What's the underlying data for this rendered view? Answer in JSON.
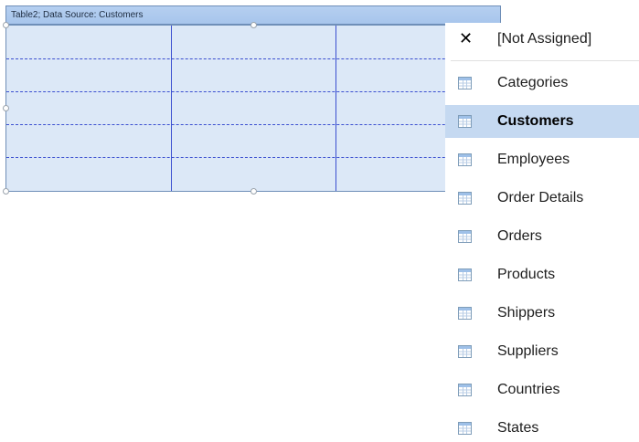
{
  "table": {
    "header_text": "Table2; Data Source: Customers",
    "columns": 3,
    "rows": 5
  },
  "menu": {
    "not_assigned": {
      "label": "[Not Assigned]",
      "icon": "close-icon"
    },
    "items": [
      {
        "label": "Categories",
        "icon": "table-icon",
        "selected": false
      },
      {
        "label": "Customers",
        "icon": "table-icon",
        "selected": true
      },
      {
        "label": "Employees",
        "icon": "table-icon",
        "selected": false
      },
      {
        "label": "Order Details",
        "icon": "table-icon",
        "selected": false
      },
      {
        "label": "Orders",
        "icon": "table-icon",
        "selected": false
      },
      {
        "label": "Products",
        "icon": "table-icon",
        "selected": false
      },
      {
        "label": "Shippers",
        "icon": "table-icon",
        "selected": false
      },
      {
        "label": "Suppliers",
        "icon": "table-icon",
        "selected": false
      },
      {
        "label": "Countries",
        "icon": "table-icon",
        "selected": false
      },
      {
        "label": "States",
        "icon": "table-icon",
        "selected": false
      }
    ]
  },
  "colors": {
    "selected_background": "#c5d9f1",
    "table_background": "#dce8f7",
    "grid_lines": "#3b4fd0",
    "header_background": "#b5cff0"
  }
}
